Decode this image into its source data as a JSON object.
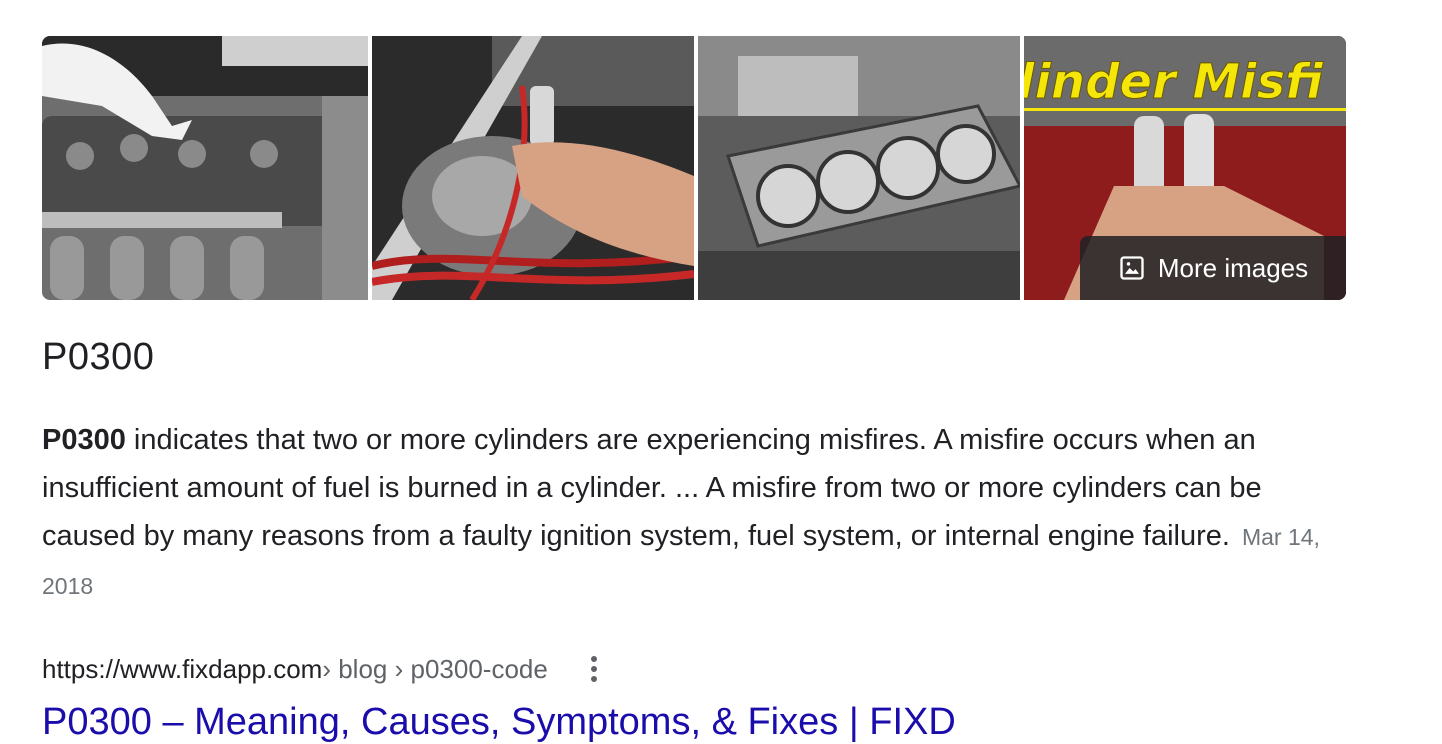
{
  "images": {
    "thumbs": [
      {
        "icon": "engine-coil-photo"
      },
      {
        "icon": "spark-plug-wires-photo"
      },
      {
        "icon": "head-gasket-photo"
      },
      {
        "icon": "cylinder-misfire-photo",
        "overlay_text": "linder Misfi"
      }
    ],
    "more_images_label": "More images",
    "more_images_icon": "image-icon"
  },
  "title": "P0300",
  "snippet": {
    "bold_term": "P0300",
    "text": " indicates that two or more cylinders are experiencing misfires. A misfire occurs when an insufficient amount of fuel is burned in a cylinder. ... A misfire from two or more cylinders can be caused by many reasons from a faulty ignition system, fuel system, or internal engine failure.",
    "date": "Mar 14, 2018"
  },
  "source": {
    "domain": "https://www.fixdapp.com",
    "breadcrumb": " › blog › p0300-code",
    "menu_icon": "more-vert-icon"
  },
  "result": {
    "link_text": "P0300 – Meaning, Causes, Symptoms, & Fixes | FIXD"
  },
  "colors": {
    "link": "#1a0dab",
    "text": "#202124",
    "muted": "#70757a",
    "overlay": "#202124"
  }
}
